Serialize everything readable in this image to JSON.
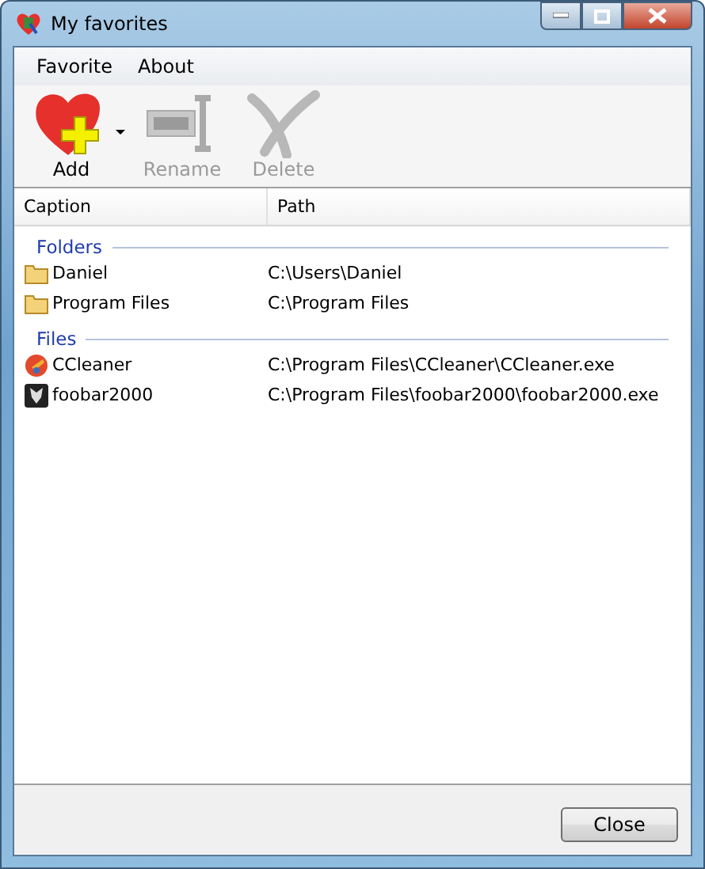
{
  "window": {
    "title": "My favorites"
  },
  "menu": [
    "Favorite",
    "About"
  ],
  "toolbar": [
    {
      "kind": "add",
      "label": "Add",
      "disabled": false,
      "dropdown": true
    },
    {
      "kind": "rename",
      "label": "Rename",
      "disabled": true,
      "dropdown": false
    },
    {
      "kind": "delete",
      "label": "Delete",
      "disabled": true,
      "dropdown": false
    }
  ],
  "list": {
    "columns": [
      "Caption",
      "Path"
    ],
    "groups": [
      {
        "name": "Folders",
        "items": [
          {
            "kind": "folder",
            "caption": "Daniel",
            "path": "C:\\Users\\Daniel"
          },
          {
            "kind": "folder",
            "caption": "Program Files",
            "path": "C:\\Program Files"
          }
        ]
      },
      {
        "name": "Files",
        "items": [
          {
            "kind": "cleaner",
            "caption": "CCleaner",
            "path": "C:\\Program Files\\CCleaner\\CCleaner.exe"
          },
          {
            "kind": "player",
            "caption": "foobar2000",
            "path": "C:\\Program Files\\foobar2000\\foobar2000.exe"
          }
        ]
      }
    ]
  },
  "buttons": [
    "Close"
  ]
}
